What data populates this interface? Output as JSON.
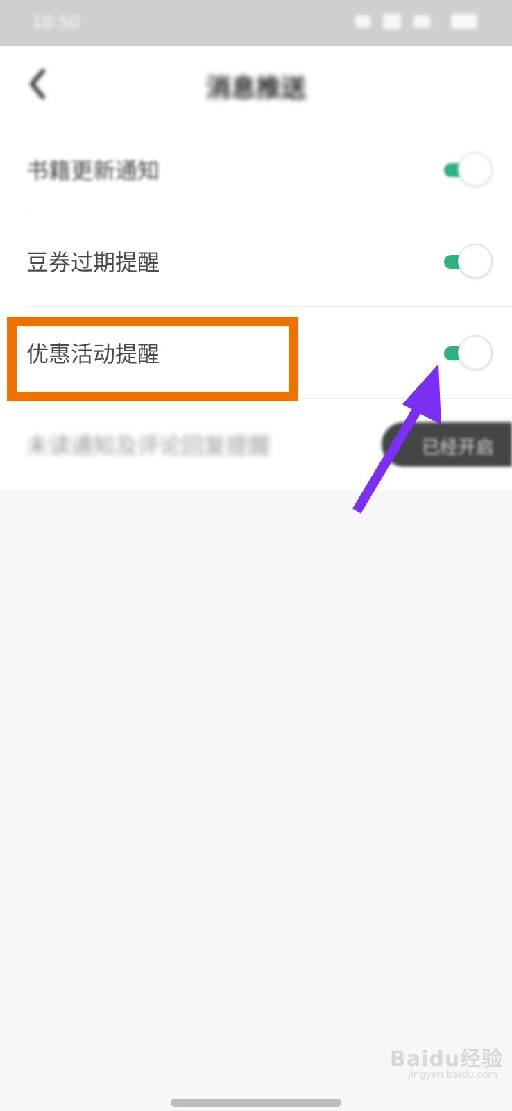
{
  "status_bar": {
    "time": "10:50"
  },
  "header": {
    "title": "消息推送"
  },
  "settings": [
    {
      "label": "书籍更新通知",
      "enabled": true
    },
    {
      "label": "豆券过期提醒",
      "enabled": true
    },
    {
      "label": "优惠活动提醒",
      "enabled": true
    },
    {
      "label": "未读通知及评论回复提醒",
      "enabled": true
    }
  ],
  "toast": {
    "text": "已经开启"
  },
  "watermark": {
    "brand": "Baidu经验",
    "url": "jingyan.baidu.com"
  },
  "colors": {
    "toggle_on": "#2fb27f",
    "highlight_box": "#ed7200",
    "arrow": "#7b2ff2"
  },
  "icons": {
    "back": "chevron-left-icon"
  }
}
